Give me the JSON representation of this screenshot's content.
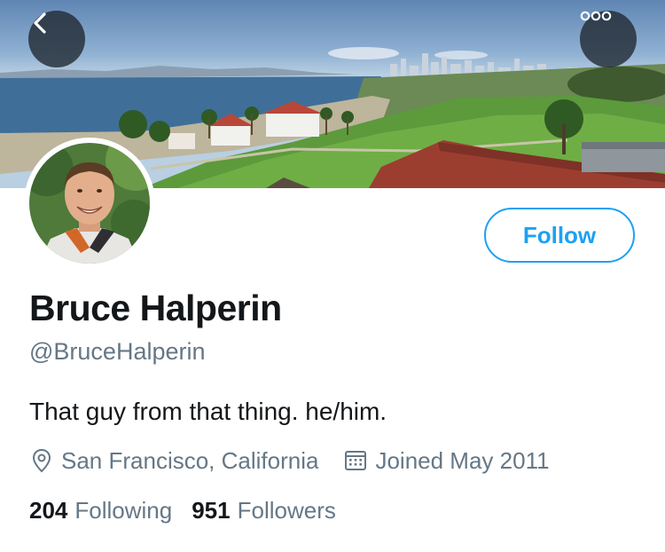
{
  "header": {
    "back_icon": "chevron-left-icon",
    "more_icon": "more-horizontal-icon",
    "banner_description": ""
  },
  "profile": {
    "name": "Bruce Halperin",
    "handle": "@BruceHalperin",
    "bio": "That guy from that thing. he/him.",
    "location": "San Francisco, California",
    "joined": "Joined May 2011",
    "follow_label": "Follow"
  },
  "stats": {
    "following_count": "204",
    "following_label": "Following",
    "followers_count": "951",
    "followers_label": "Followers"
  },
  "colors": {
    "accent": "#1da1f2",
    "text_primary": "#14171a",
    "text_secondary": "#657786"
  }
}
